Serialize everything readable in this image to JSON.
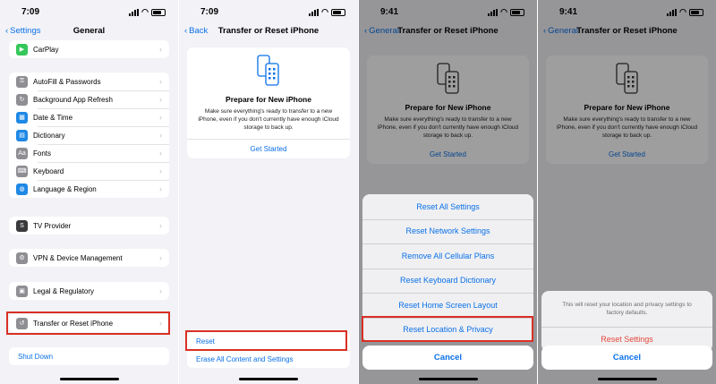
{
  "panel1": {
    "time": "7:09",
    "back_label": "Settings",
    "title": "General",
    "group0": [
      {
        "label": "CarPlay",
        "color": "#34c759",
        "icon": "carplay-icon"
      }
    ],
    "group1": [
      {
        "label": "AutoFill & Passwords",
        "color": "#8e8e93",
        "icon": "key-icon"
      },
      {
        "label": "Background App Refresh",
        "color": "#8e8e93",
        "icon": "refresh-icon"
      },
      {
        "label": "Date & Time",
        "color": "#1e88e5",
        "icon": "calendar-icon"
      },
      {
        "label": "Dictionary",
        "color": "#1e88e5",
        "icon": "book-icon"
      },
      {
        "label": "Fonts",
        "color": "#8e8e93",
        "icon": "fonts-icon"
      },
      {
        "label": "Keyboard",
        "color": "#8e8e93",
        "icon": "keyboard-icon"
      },
      {
        "label": "Language & Region",
        "color": "#1e88e5",
        "icon": "globe-icon"
      }
    ],
    "group2": [
      {
        "label": "TV Provider",
        "color": "#3a3a3c",
        "icon": "tv-provider-icon"
      }
    ],
    "group3": [
      {
        "label": "VPN & Device Management",
        "color": "#8e8e93",
        "icon": "gear-icon"
      }
    ],
    "group4": [
      {
        "label": "Legal & Regulatory",
        "color": "#8e8e93",
        "icon": "legal-icon"
      }
    ],
    "group5": [
      {
        "label": "Transfer or Reset iPhone",
        "color": "#8e8e93",
        "icon": "reset-icon"
      }
    ],
    "shutdown": "Shut Down"
  },
  "panel2": {
    "time": "7:09",
    "back_label": "Back",
    "title": "Transfer or Reset iPhone",
    "card_title": "Prepare for New iPhone",
    "card_text": "Make sure everything's ready to transfer to a new iPhone, even if you don't currently have enough iCloud storage to back up.",
    "get_started": "Get Started",
    "reset": "Reset",
    "erase": "Erase All Content and Settings"
  },
  "panel3": {
    "time": "9:41",
    "back_label": "General",
    "title": "Transfer or Reset iPhone",
    "card_title": "Prepare for New iPhone",
    "card_text": "Make sure everything's ready to transfer to a new iPhone, even if you don't currently have enough iCloud storage to back up.",
    "get_started": "Get Started",
    "options": [
      "Reset All Settings",
      "Reset Network Settings",
      "Remove All Cellular Plans",
      "Reset Keyboard Dictionary",
      "Reset Home Screen Layout",
      "Reset Location & Privacy"
    ],
    "cancel": "Cancel"
  },
  "panel4": {
    "time": "9:41",
    "back_label": "General",
    "title": "Transfer or Reset iPhone",
    "card_title": "Prepare for New iPhone",
    "card_text": "Make sure everything's ready to transfer to a new iPhone, even if you don't currently have enough iCloud storage to back up.",
    "get_started": "Get Started",
    "message": "This will reset your location and privacy settings to factory defaults.",
    "confirm": "Reset Settings",
    "cancel": "Cancel"
  },
  "colors": {
    "accent": "#0a70e8",
    "highlight": "#d93025",
    "destructive": "#e5483d"
  }
}
